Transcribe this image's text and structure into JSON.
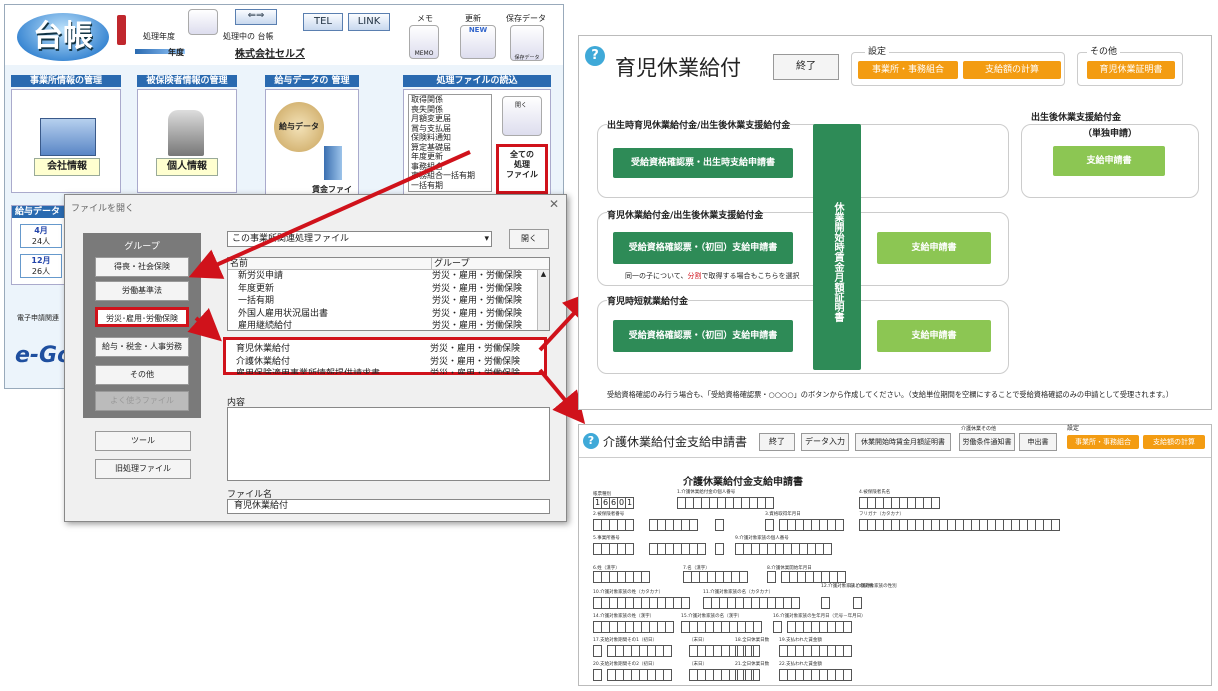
{
  "main": {
    "logo": "台帳",
    "year_label": "処理年度",
    "year_value": "年度",
    "company_label": "処理中の 台帳",
    "company": "株式会社セルズ",
    "buttons": {
      "tel": "TEL",
      "link": "LINK",
      "memo": "メモ",
      "memo_sub": "MEMO",
      "update": "更新",
      "update_badge": "NEW",
      "save": "保存データ",
      "save_sub": "保存データ"
    },
    "sections": {
      "office": "事業所情報の管理",
      "insured": "被保険者情報の管理",
      "salary": "給与データの 管理",
      "process": "処理ファイルの読込"
    },
    "icons": {
      "office": "会社情報",
      "person": "個人情報",
      "salary": "給与データ",
      "wage": "賃金ファイル"
    },
    "process_list": [
      "取得関係",
      "喪失関係",
      "月額変更届",
      "賞与支払届",
      "保険料通知",
      "算定基礎届",
      "年度更新",
      "事務組合",
      "事務組合一括有期",
      "一括有期"
    ],
    "open_label": "開く",
    "all_files": "全ての\n処理\nファイル",
    "salary_data": {
      "title": "給与データ",
      "rows": [
        {
          "month": "4月",
          "count": "24人"
        },
        {
          "month": "12月",
          "count": "26人"
        }
      ]
    },
    "egov_label": "電子申請関連",
    "egov_logo": "e-Gov"
  },
  "dialog": {
    "title": "ファイルを開く",
    "group_header": "グループ",
    "groups": [
      "得喪・社会保険",
      "労働基準法",
      "労災･雇用･労働保険",
      "給与・税金・人事労務",
      "その他",
      "よく使うファイル"
    ],
    "tools": "ツール",
    "old_files": "旧処理ファイル",
    "filter": "この事業所関連処理ファイル",
    "open_btn": "開く",
    "col_name": "名前",
    "col_group": "グループ",
    "rows": [
      {
        "name": "新労災申請",
        "group": "労災・雇用・労働保険"
      },
      {
        "name": "年度更新",
        "group": "労災・雇用・労働保険"
      },
      {
        "name": "一括有期",
        "group": "労災・雇用・労働保険"
      },
      {
        "name": "外国人雇用状況届出書",
        "group": "労災・雇用・労働保険"
      },
      {
        "name": "雇用継続給付",
        "group": "労災・雇用・労働保険"
      },
      {
        "name": "育児休業給付",
        "group": "労災・雇用・労働保険"
      },
      {
        "name": "介護休業給付",
        "group": "労災・雇用・労働保険"
      },
      {
        "name": "雇用保険適用事業所情報提供請求書",
        "group": "労災・雇用・労働保険"
      }
    ],
    "content_label": "内容",
    "filename_label": "ファイル名",
    "filename": "育児休業給付"
  },
  "ikukyu": {
    "title": "育児休業給付",
    "end": "終了",
    "settings": "設定",
    "office_btn": "事業所・事務組合",
    "calc_btn": "支給額の計算",
    "other": "その他",
    "cert_btn": "育児休業証明書",
    "sec1": "出生時育児休業給付金/出生後休業支援給付金",
    "sec1_btn": "受給資格確認票・出生時支給申請書",
    "sec2": "育児休業給付金/出生後休業支援給付金",
    "sec2_btn": "受給資格確認票・（初回）支給申請書",
    "sec2_btn2": "支給申請書",
    "sec2_note": "同一の子について、",
    "sec2_note_red": "分割",
    "sec2_note2": "で取得する場合もこちらを選択",
    "sec3": "育児時短就業給付金",
    "sec3_btn": "受給資格確認票・（初回）支給申請書",
    "sec3_btn2": "支給申請書",
    "vertical": "休業開始時賃金月額証明書",
    "sec4": "出生後休業支援給付金",
    "sec4_sub": "（単独申請）",
    "sec4_btn": "支給申請書",
    "footer": "受給資格確認のみ行う場合も、「受給資格確認票・○○○○」のボタンから作成してください。（支給単位期間を空欄にすることで受給資格確認のみの申請として受理されます。）"
  },
  "kaigo": {
    "title": "介護休業給付金支給申請書",
    "end": "終了",
    "data_in": "データ入力",
    "wage_cert": "休業開始時賃金月額証明書",
    "cond_small": "介護休業その他",
    "cond": "労働条件通知書",
    "submit": "申出書",
    "settings": "設定",
    "office_btn": "事業所・事務組合",
    "calc_btn": "支給額の計算",
    "form_title": "介護休業給付金支給申請書",
    "code_label": "帳票種別",
    "code": [
      "1",
      "6",
      "6",
      "0",
      "1"
    ],
    "labels": [
      "1.介護休業給付金の個人番号",
      "4.被保険者氏名",
      "2.被保険者番号",
      "3.資格取得年月日",
      "フリガナ（カタカナ）",
      "5.事業所番号",
      "9.介護対象家族の個人番号",
      "6.姓（漢字）",
      "7.名（漢字）",
      "8.介護休業開始年月日",
      "10.介護対象家族の姓（カタカナ）",
      "11.介護対象家族の名（カタカナ）",
      "12.介護対象家族との続柄",
      "13.介護対象家族の性別",
      "14.介護対象家族の姓（漢字）",
      "15.介護対象家族の名（漢字）",
      "16.介護対象家族の生年月日（元号－年月日）",
      "17.支給対象期間その1（初日）",
      "（末日）",
      "18.全日休業日数",
      "19.支払われた賃金額",
      "20.支給対象期間その2（初日）",
      "（末日）",
      "21.全日休業日数",
      "22.支払われた賃金額"
    ]
  },
  "colors": {
    "accent": "#d0121b",
    "green": "#2e8b57",
    "light_green": "#8cc653",
    "orange": "#f39c12",
    "blue": "#2a6ab0"
  }
}
